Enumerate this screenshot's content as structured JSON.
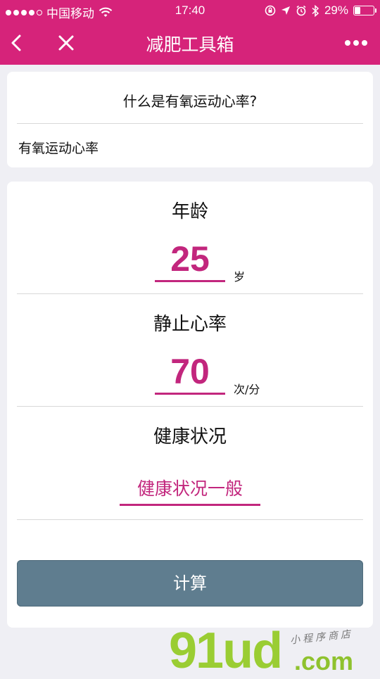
{
  "status_bar": {
    "carrier": "中国移动",
    "time": "17:40",
    "battery": "29%",
    "battery_level": 0.29
  },
  "nav": {
    "title": "减肥工具箱",
    "back_icon": "chevron-left-icon",
    "close_icon": "close-icon",
    "more_icon": "more-icon"
  },
  "info_card": {
    "question": "什么是有氧运动心率?",
    "answer": "有氧运动心率"
  },
  "form": {
    "age": {
      "label": "年龄",
      "value": "25",
      "unit": "岁"
    },
    "resting_hr": {
      "label": "静止心率",
      "value": "70",
      "unit": "次/分"
    },
    "health": {
      "label": "健康状况",
      "value": "健康状况一般"
    },
    "submit_label": "计算"
  },
  "watermark": {
    "logo": "91ud",
    "domain": ".com",
    "subtitle": "小程序商店"
  },
  "colors": {
    "brand": "#d6237a",
    "accent": "#c2267d",
    "button": "#5f7d8f",
    "background": "#efeff4"
  }
}
